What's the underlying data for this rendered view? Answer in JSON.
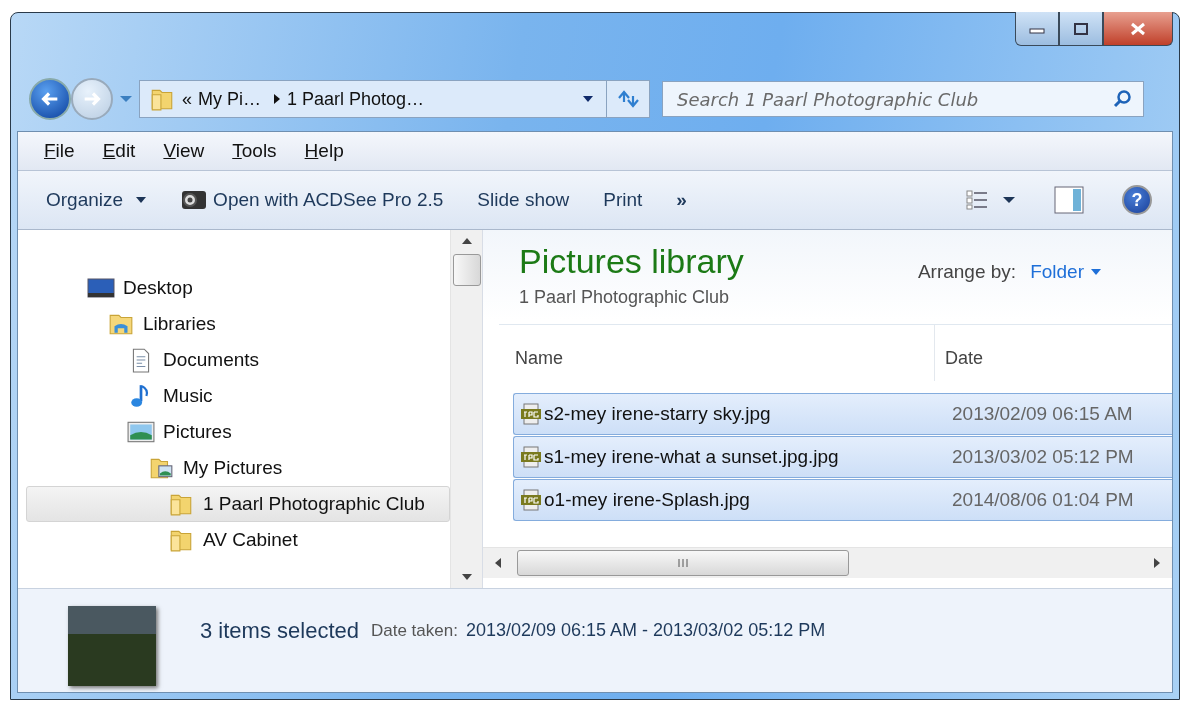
{
  "address": {
    "overflow": "«",
    "segments": [
      "My Pi…",
      "1 Paarl Photog…"
    ]
  },
  "search": {
    "placeholder": "Search 1 Paarl Photographic Club"
  },
  "menu": [
    "File",
    "Edit",
    "View",
    "Tools",
    "Help"
  ],
  "toolbar": [
    {
      "label": "Organize",
      "kind": "dropdown"
    },
    {
      "label": "Open with ACDSee Pro 2.5",
      "kind": "app"
    },
    {
      "label": "Slide show",
      "kind": "plain"
    },
    {
      "label": "Print",
      "kind": "plain"
    },
    {
      "label": "»",
      "kind": "more"
    }
  ],
  "help_glyph": "?",
  "tree": [
    {
      "label": "Desktop",
      "kind": "desktop",
      "selected": false,
      "children": [
        {
          "label": "Libraries",
          "kind": "library",
          "selected": false,
          "children": [
            {
              "label": "Documents",
              "kind": "document",
              "selected": false
            },
            {
              "label": "Music",
              "kind": "music",
              "selected": false
            },
            {
              "label": "Pictures",
              "kind": "pictures",
              "selected": false,
              "children": [
                {
                  "label": "My Pictures",
                  "kind": "picfolder",
                  "selected": false,
                  "children": [
                    {
                      "label": "1 Paarl Photographic Club",
                      "kind": "folder",
                      "selected": true
                    },
                    {
                      "label": "AV Cabinet",
                      "kind": "folder",
                      "selected": false
                    }
                  ]
                }
              ]
            }
          ]
        }
      ]
    }
  ],
  "library": {
    "title": "Pictures library",
    "subtitle": "1 Paarl Photographic Club",
    "arrange_label": "Arrange by:",
    "arrange_value": "Folder"
  },
  "columns": [
    "Name",
    "Date"
  ],
  "rows": [
    {
      "name": "s2-mey irene-starry sky.jpg",
      "date": "2013/02/09 06:15 AM",
      "selected": true
    },
    {
      "name": "s1-mey irene-what a sunset.jpg.jpg",
      "date": "2013/03/02 05:12 PM",
      "selected": true
    },
    {
      "name": "o1-mey irene-Splash.jpg",
      "date": "2014/08/06 01:04 PM",
      "selected": true
    }
  ],
  "details": {
    "count": "3 items selected",
    "label": "Date taken:",
    "value": "2013/02/09 06:15 AM - 2013/03/02 05:12 PM"
  }
}
